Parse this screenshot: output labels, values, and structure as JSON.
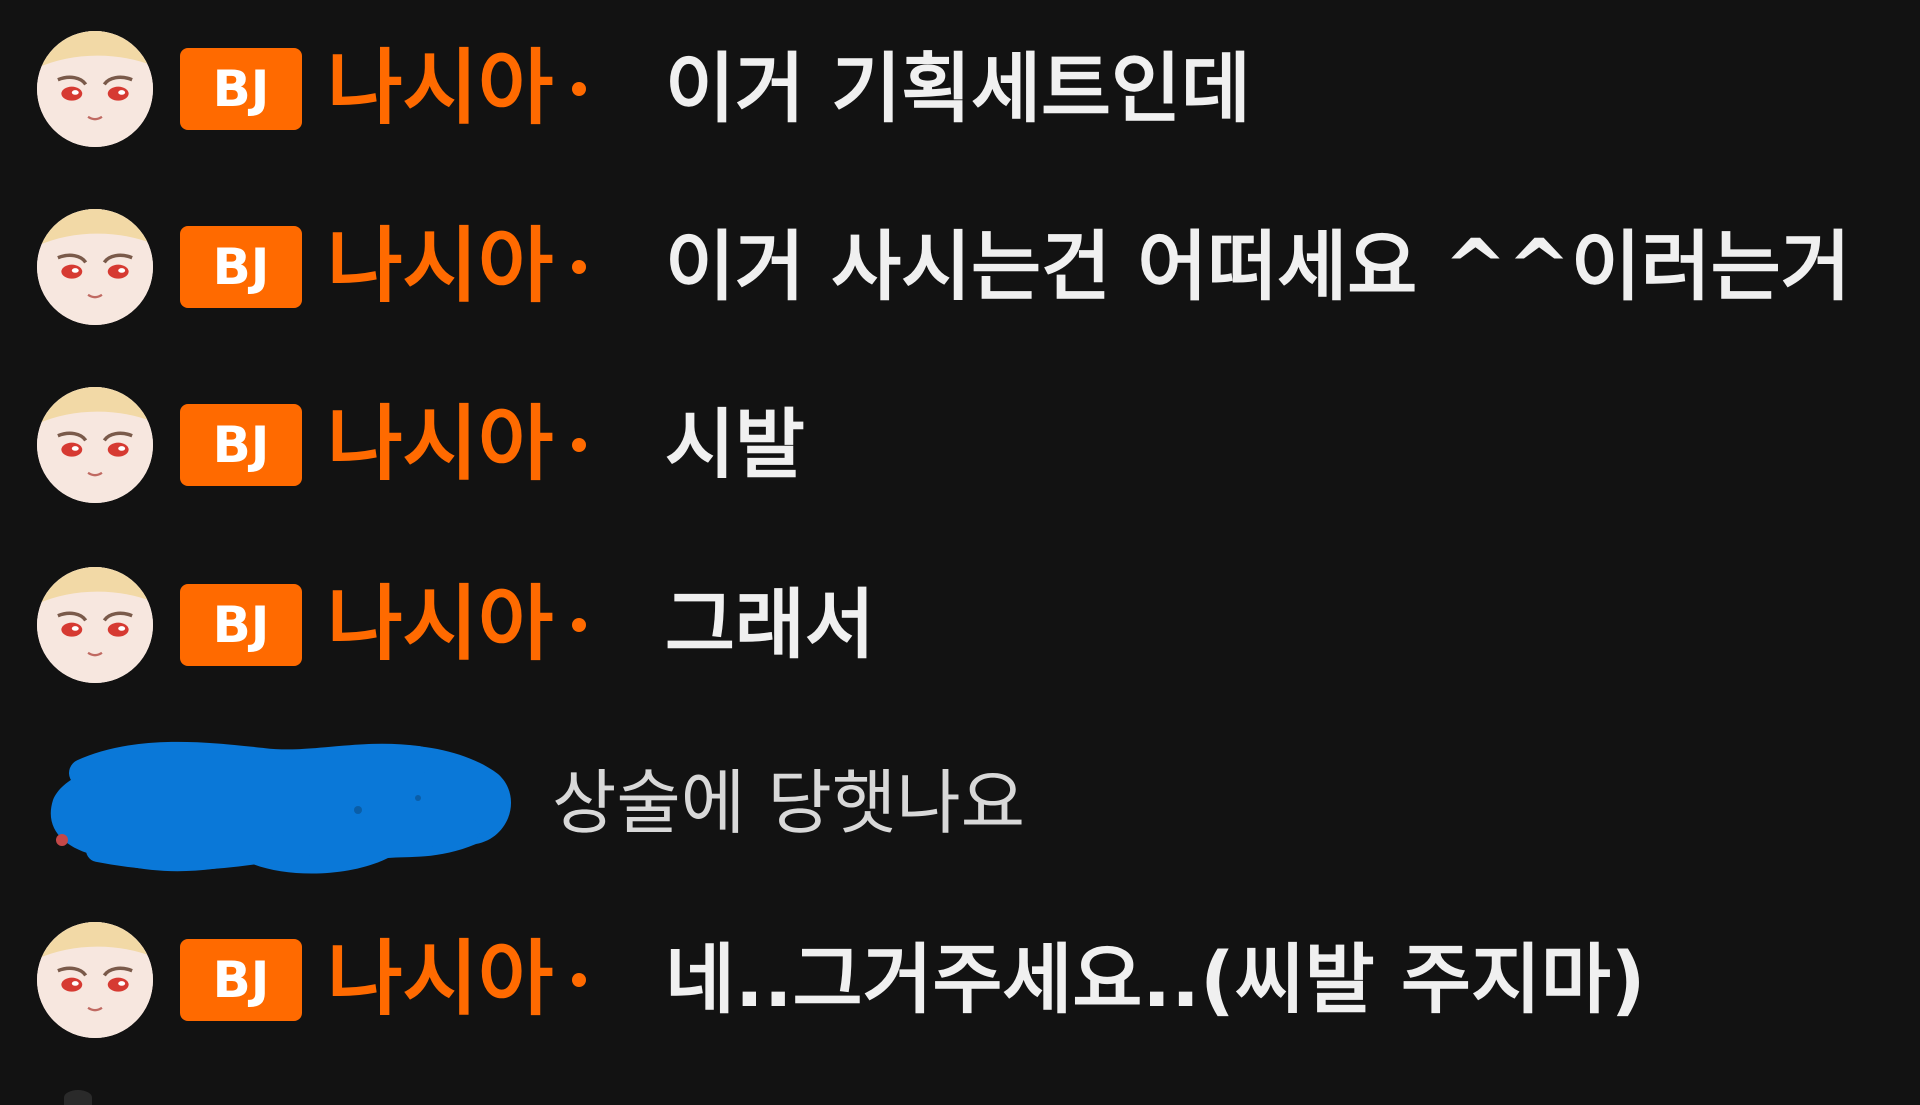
{
  "chat": {
    "messages": [
      {
        "kind": "bj",
        "badge": "BJ",
        "nickname": "나시아",
        "text": "이거 기획세트인데"
      },
      {
        "kind": "bj",
        "badge": "BJ",
        "nickname": "나시아",
        "text": "이거 사시는건 어떠세요 ^^이러는거"
      },
      {
        "kind": "bj",
        "badge": "BJ",
        "nickname": "나시아",
        "text": "시발"
      },
      {
        "kind": "bj",
        "badge": "BJ",
        "nickname": "나시아",
        "text": "그래서"
      },
      {
        "kind": "viewer",
        "text": "상술에 당햇나요"
      },
      {
        "kind": "bj",
        "badge": "BJ",
        "nickname": "나시아",
        "text": "네..그거주세요..(씨발 주지마)"
      }
    ]
  },
  "colors": {
    "background": "#121212",
    "accent": "#ff6a00",
    "message_text": "#f0f0f0",
    "viewer_text": "#d8d8d8",
    "redaction": "#0a78d8"
  },
  "icons": {
    "bj_avatar": "streamer-avatar-icon",
    "viewer_name": "redacted-username-scribble"
  }
}
